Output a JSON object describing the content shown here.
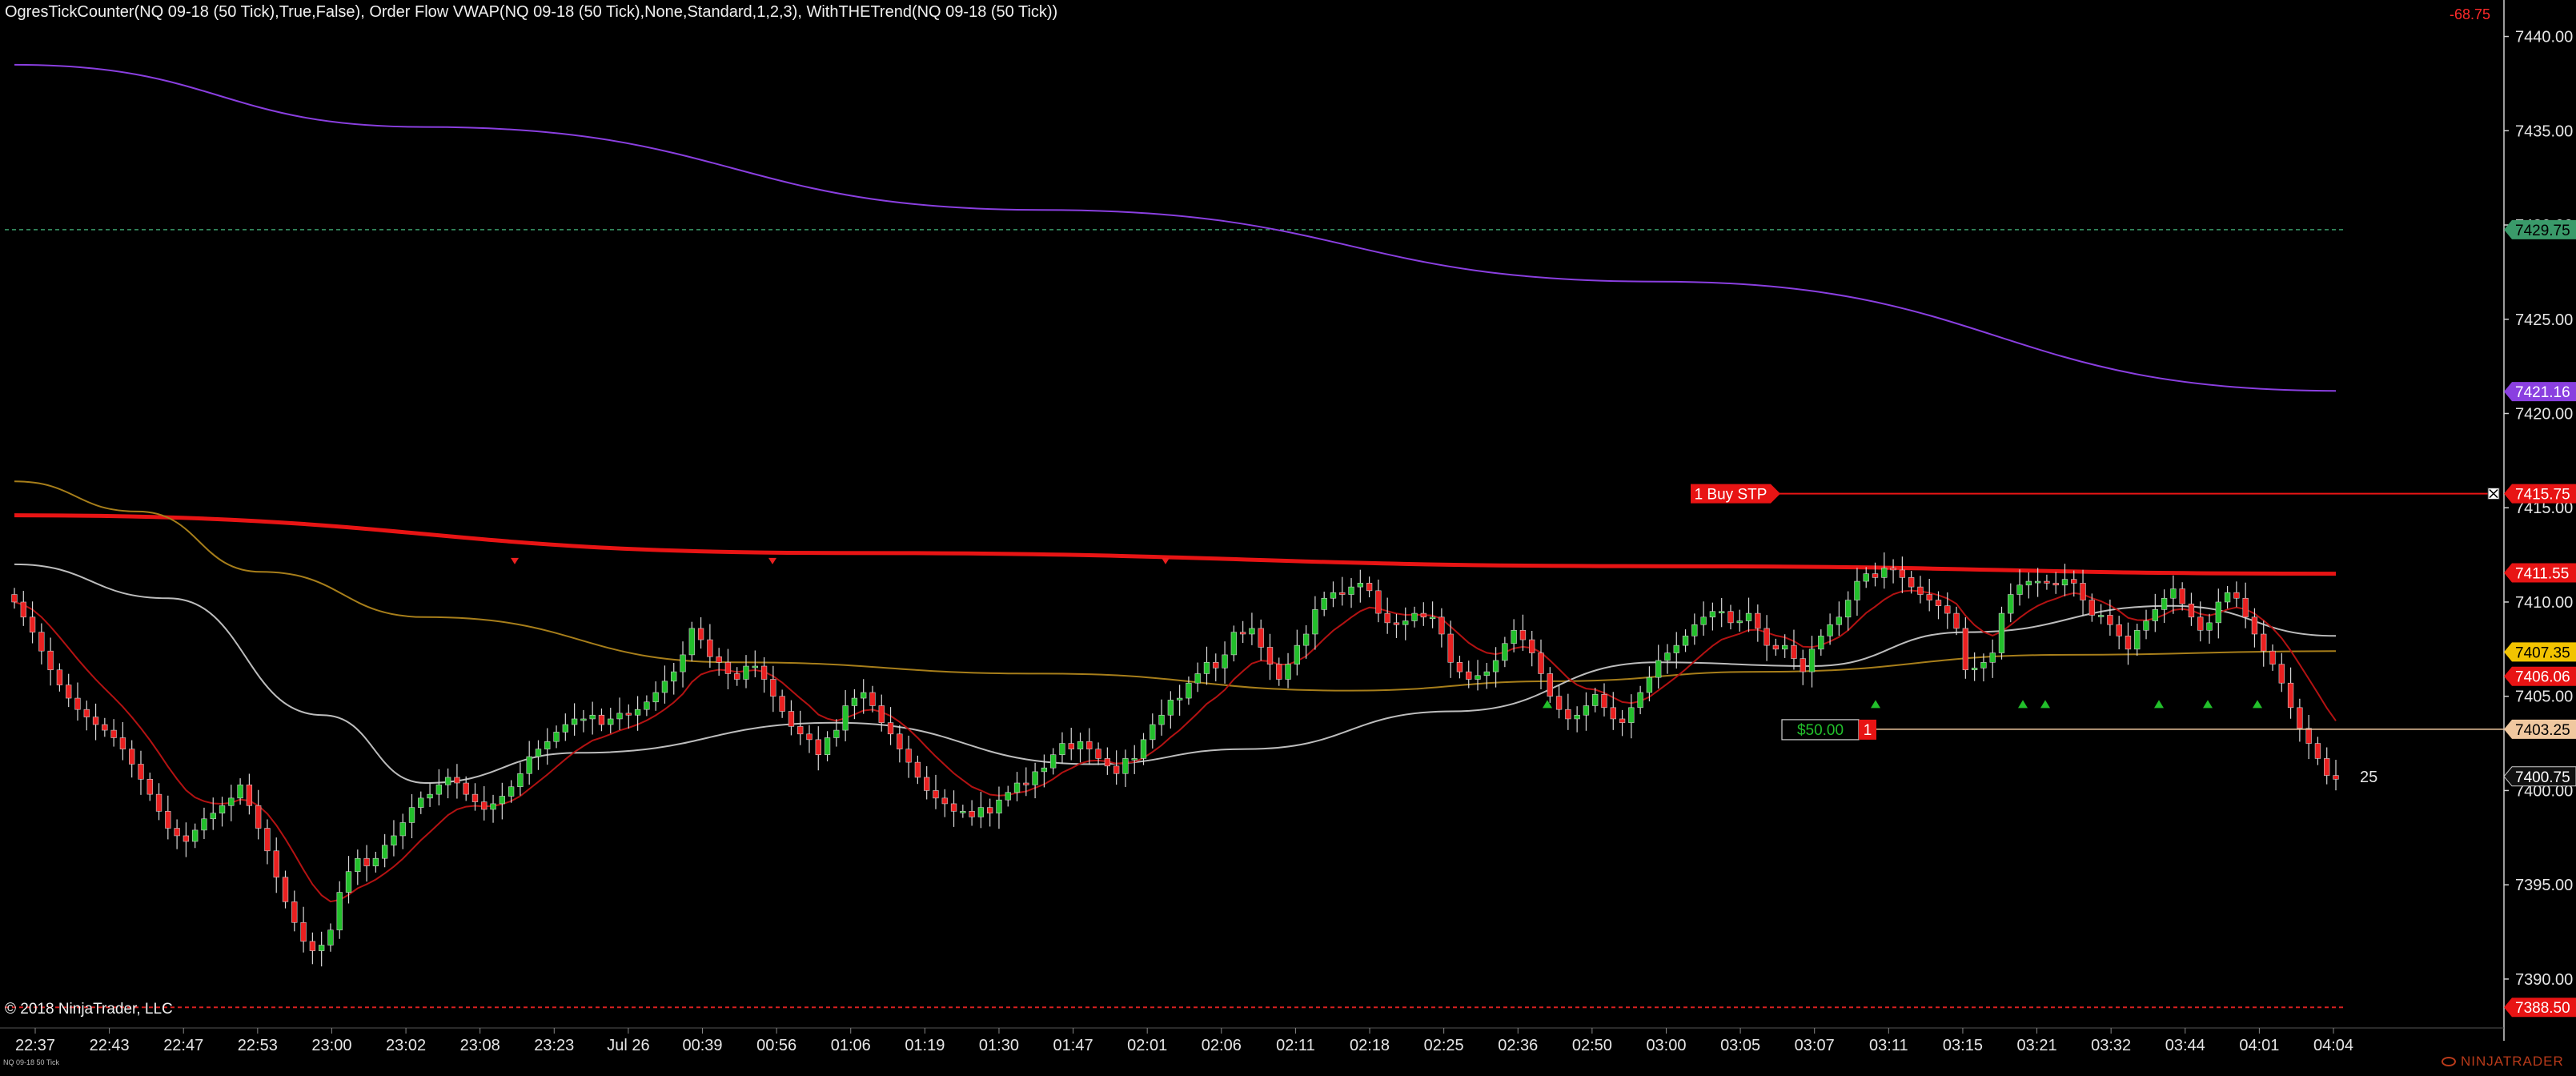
{
  "header": {
    "indicator_text": "OgresTickCounter(NQ 09-18 (50 Tick),True,False), Order Flow VWAP(NQ 09-18 (50 Tick),None,Standard,1,2,3), WithTHETrend(NQ 09-18 (50 Tick))",
    "pnl": "-68.75"
  },
  "footer": {
    "copyright": "© 2018 NinjaTrader, LLC",
    "instrument_tiny": "NQ 09-18 50 Tick",
    "logo_text": "NINJATRADER"
  },
  "orders": {
    "stop_label": "1 Buy STP",
    "stop_price": 7415.75,
    "position_pnl": "$50.00",
    "position_qty": "1",
    "position_price": 7403.25,
    "tick_count": "25"
  },
  "colors": {
    "up_candle": "#22c02b",
    "down_candle": "#ea2020",
    "vwap_main": "#8a3fe0",
    "trend_line": "#e81414",
    "fast_ma": "#b31212",
    "slow_ma_grey": "#bdbdbd",
    "gold_ma": "#a77e1a",
    "dashed_green": "#3a9a6a",
    "dashed_red": "#d82020"
  },
  "chart_data": {
    "type": "candlestick",
    "ylim": [
      7388.0,
      7441.0
    ],
    "y_ticks": [
      7390.0,
      7395.0,
      7400.0,
      7405.0,
      7410.0,
      7415.0,
      7420.0,
      7425.0,
      7430.0,
      7435.0,
      7440.0
    ],
    "x_tick_labels": [
      "22:37",
      "22:43",
      "22:47",
      "22:53",
      "23:00",
      "23:02",
      "23:08",
      "23:23",
      "Jul 26",
      "00:39",
      "00:56",
      "01:06",
      "01:19",
      "01:30",
      "01:47",
      "02:01",
      "02:06",
      "02:11",
      "02:18",
      "02:25",
      "02:36",
      "02:50",
      "03:00",
      "03:05",
      "03:07",
      "03:11",
      "03:15",
      "03:21",
      "03:32",
      "03:44",
      "04:01",
      "04:04"
    ],
    "price_markers": [
      {
        "value": "7429.75",
        "color": "#3a9a6a",
        "text_color": "#000000"
      },
      {
        "value": "7421.16",
        "color": "#8a3fe0",
        "text_color": "#ffffff"
      },
      {
        "value": "7415.75",
        "color": "#e81414",
        "text_color": "#ffffff"
      },
      {
        "value": "7411.55",
        "color": "#e81414",
        "text_color": "#ffffff"
      },
      {
        "value": "7407.35",
        "color": "#f2c300",
        "text_color": "#000000"
      },
      {
        "value": "7406.06",
        "color": "#e81414",
        "text_color": "#ffffff"
      },
      {
        "value": "7403.25",
        "color": "#f0c8a0",
        "text_color": "#000000"
      },
      {
        "value": "7400.75",
        "color": "#111111",
        "text_color": "#ffffff"
      },
      {
        "value": "7388.50",
        "color": "#e81414",
        "text_color": "#ffffff"
      }
    ],
    "closes": [
      7410.0,
      7409.2,
      7408.4,
      7407.4,
      7406.4,
      7405.6,
      7404.9,
      7404.3,
      7403.9,
      7403.5,
      7403.2,
      7402.8,
      7402.2,
      7401.4,
      7400.6,
      7399.8,
      7398.9,
      7398.0,
      7397.6,
      7397.3,
      7397.9,
      7398.5,
      7398.8,
      7399.2,
      7399.6,
      7400.3,
      7399.2,
      7398.0,
      7396.8,
      7395.4,
      7394.1,
      7393.0,
      7392.0,
      7391.5,
      7391.8,
      7392.6,
      7394.6,
      7395.7,
      7396.4,
      7396.0,
      7396.4,
      7397.1,
      7397.6,
      7398.3,
      7399.1,
      7399.6,
      7399.8,
      7400.3,
      7400.7,
      7400.4,
      7399.8,
      7399.4,
      7399.0,
      7399.3,
      7399.7,
      7400.2,
      7400.9,
      7401.8,
      7402.2,
      7402.6,
      7403.1,
      7403.5,
      7403.8,
      7403.8,
      7404.0,
      7403.5,
      7403.8,
      7404.1,
      7404.0,
      7404.3,
      7404.7,
      7405.2,
      7405.8,
      7406.3,
      7407.2,
      7408.6,
      7408.0,
      7407.1,
      7406.8,
      7406.2,
      7405.9,
      7406.6,
      7406.6,
      7405.9,
      7405.0,
      7404.2,
      7403.4,
      7403.0,
      7402.7,
      7401.9,
      7402.8,
      7403.2,
      7404.5,
      7404.9,
      7405.2,
      7404.5,
      7403.6,
      7403.0,
      7402.2,
      7401.5,
      7400.7,
      7400.0,
      7399.6,
      7399.3,
      7398.9,
      7398.9,
      7398.6,
      7399.1,
      7398.8,
      7399.5,
      7399.9,
      7400.4,
      7400.3,
      7401.0,
      7401.2,
      7401.9,
      7402.5,
      7402.2,
      7402.6,
      7402.2,
      7401.7,
      7401.3,
      7400.9,
      7401.7,
      7401.7,
      7402.7,
      7403.5,
      7404.0,
      7404.8,
      7404.9,
      7405.7,
      7406.2,
      7406.8,
      7406.5,
      7407.2,
      7408.4,
      7408.3,
      7408.6,
      7407.6,
      7406.7,
      7405.9,
      7406.7,
      7407.7,
      7408.3,
      7409.6,
      7410.2,
      7410.5,
      7410.4,
      7410.8,
      7411.0,
      7410.6,
      7409.4,
      7408.9,
      7408.8,
      7409.0,
      7409.4,
      7409.2,
      7409.2,
      7408.3,
      7406.8,
      7406.3,
      7405.9,
      7406.1,
      7406.3,
      7406.9,
      7407.8,
      7408.5,
      7408.0,
      7407.3,
      7406.2,
      7405.0,
      7404.3,
      7403.8,
      7404.0,
      7404.5,
      7405.1,
      7404.4,
      7403.8,
      7403.6,
      7404.4,
      7405.2,
      7406.0,
      7406.9,
      7407.3,
      7407.7,
      7408.2,
      7408.8,
      7409.2,
      7409.5,
      7409.5,
      7408.9,
      7409.0,
      7409.4,
      7408.6,
      7407.7,
      7407.5,
      7407.7,
      7407.0,
      7406.3,
      7407.5,
      7408.2,
      7408.8,
      7409.2,
      7410.1,
      7411.1,
      7411.5,
      7411.3,
      7411.8,
      7411.7,
      7411.3,
      7410.8,
      7410.4,
      7410.1,
      7409.8,
      7409.4,
      7408.6,
      7406.4,
      7406.5,
      7406.8,
      7407.3,
      7409.4,
      7410.4,
      7410.9,
      7411.1,
      7411.1,
      7411.0,
      7410.9,
      7411.2,
      7411.0,
      7410.1,
      7409.3,
      7409.3,
      7408.8,
      7408.2,
      7407.5,
      7408.5,
      7409.0,
      7409.6,
      7410.2,
      7410.7,
      7409.9,
      7409.2,
      7408.5,
      7408.9,
      7410.0,
      7410.5,
      7410.2,
      7409.2,
      7408.3,
      7407.4,
      7406.7,
      7405.7,
      7404.4,
      7403.3,
      7402.5,
      7401.7,
      7400.8,
      7400.6
    ],
    "vwap_series": [
      {
        "name": "vwap-purple",
        "points": [
          [
            0,
            7438.5
          ],
          [
            40,
            7435.2
          ],
          [
            100,
            7430.8
          ],
          [
            160,
            7427.0
          ],
          [
            226,
            7421.2
          ]
        ]
      },
      {
        "name": "trend-red",
        "points": [
          [
            0,
            7414.6
          ],
          [
            80,
            7412.6
          ],
          [
            160,
            7411.9
          ],
          [
            226,
            7411.5
          ]
        ]
      },
      {
        "name": "gold-ma",
        "points": [
          [
            0,
            7416.4
          ],
          [
            12,
            7414.8
          ],
          [
            24,
            7411.6
          ],
          [
            40,
            7409.2
          ],
          [
            70,
            7406.8
          ],
          [
            100,
            7406.2
          ],
          [
            130,
            7405.3
          ],
          [
            150,
            7405.8
          ],
          [
            170,
            7406.3
          ],
          [
            200,
            7407.2
          ],
          [
            226,
            7407.4
          ]
        ]
      },
      {
        "name": "grey-ma",
        "points": [
          [
            0,
            7412.0
          ],
          [
            15,
            7410.2
          ],
          [
            30,
            7404.0
          ],
          [
            40,
            7400.4
          ],
          [
            55,
            7402.0
          ],
          [
            80,
            7403.6
          ],
          [
            105,
            7401.4
          ],
          [
            120,
            7402.2
          ],
          [
            140,
            7404.2
          ],
          [
            160,
            7406.8
          ],
          [
            175,
            7406.6
          ],
          [
            190,
            7408.4
          ],
          [
            210,
            7409.8
          ],
          [
            226,
            7408.2
          ]
        ]
      }
    ]
  }
}
